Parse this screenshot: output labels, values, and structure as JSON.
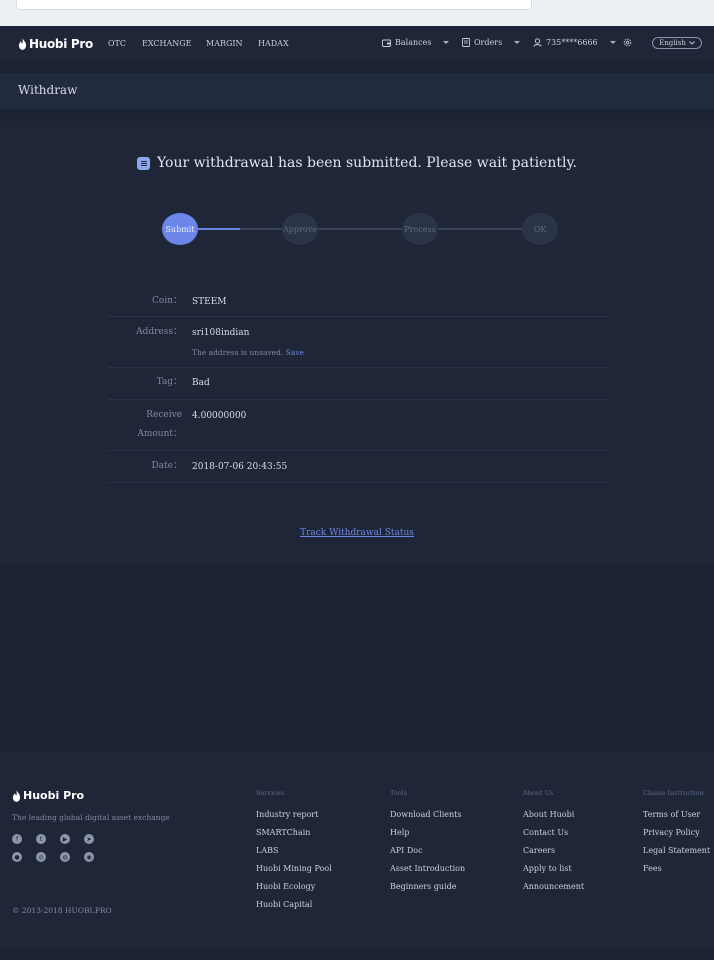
{
  "nav": {
    "logo_text": "Huobi Pro",
    "links": [
      "OTC",
      "EXCHANGE",
      "MARGIN",
      "HADAX"
    ],
    "balances": "Balances",
    "orders": "Orders",
    "account": "735****6666",
    "language": "English"
  },
  "page_title": "Withdraw",
  "headline": "Your withdrawal has been submitted. Please wait patiently.",
  "steps": [
    "Submit",
    "Approve",
    "Process",
    "OK"
  ],
  "steps_completed": 1,
  "details": {
    "coin_label": "Coin：",
    "coin_value": "STEEM",
    "address_label": "Address：",
    "address_value": "sri108indian",
    "address_note": "The address is unsaved.",
    "address_save": "Save",
    "tag_label": "Tag：",
    "tag_value": "Bad",
    "receive_label_1": "Receive",
    "receive_label_2": "Amount：",
    "receive_value": "4.00000000",
    "date_label": "Date：",
    "date_value": "2018-07-06 20:43:55"
  },
  "track_link": "Track Withdrawal Status",
  "footer": {
    "logo_text": "Huobi Pro",
    "tagline": "The leading global digital asset exchange",
    "copyright": "© 2013-2018 HUOBI.PRO",
    "social_icons": [
      "facebook-icon",
      "twitter-icon",
      "youtube-icon",
      "telegram-icon",
      "medium-icon",
      "instagram-icon",
      "wechat-icon",
      "weibo-icon"
    ],
    "columns": [
      {
        "heading": "Services",
        "items": [
          "Industry report",
          "SMARTChain",
          "LABS",
          "Huobi Mining Pool",
          "Huobi Ecology",
          "Huobi Capital"
        ]
      },
      {
        "heading": "Tools",
        "items": [
          "Download Clients",
          "Help",
          "API Doc",
          "Asset Introduction",
          "Beginners guide"
        ]
      },
      {
        "heading": "About Us",
        "items": [
          "About Huobi",
          "Contact Us",
          "Careers",
          "Apply to list",
          "Announcement"
        ]
      },
      {
        "heading": "Clause Instruction",
        "items": [
          "Terms of User",
          "Privacy Policy",
          "Legal Statement",
          "Fees"
        ]
      }
    ]
  },
  "colors": {
    "accent": "#6b86e8",
    "background": "#1b2233",
    "panel": "#1f2638"
  }
}
